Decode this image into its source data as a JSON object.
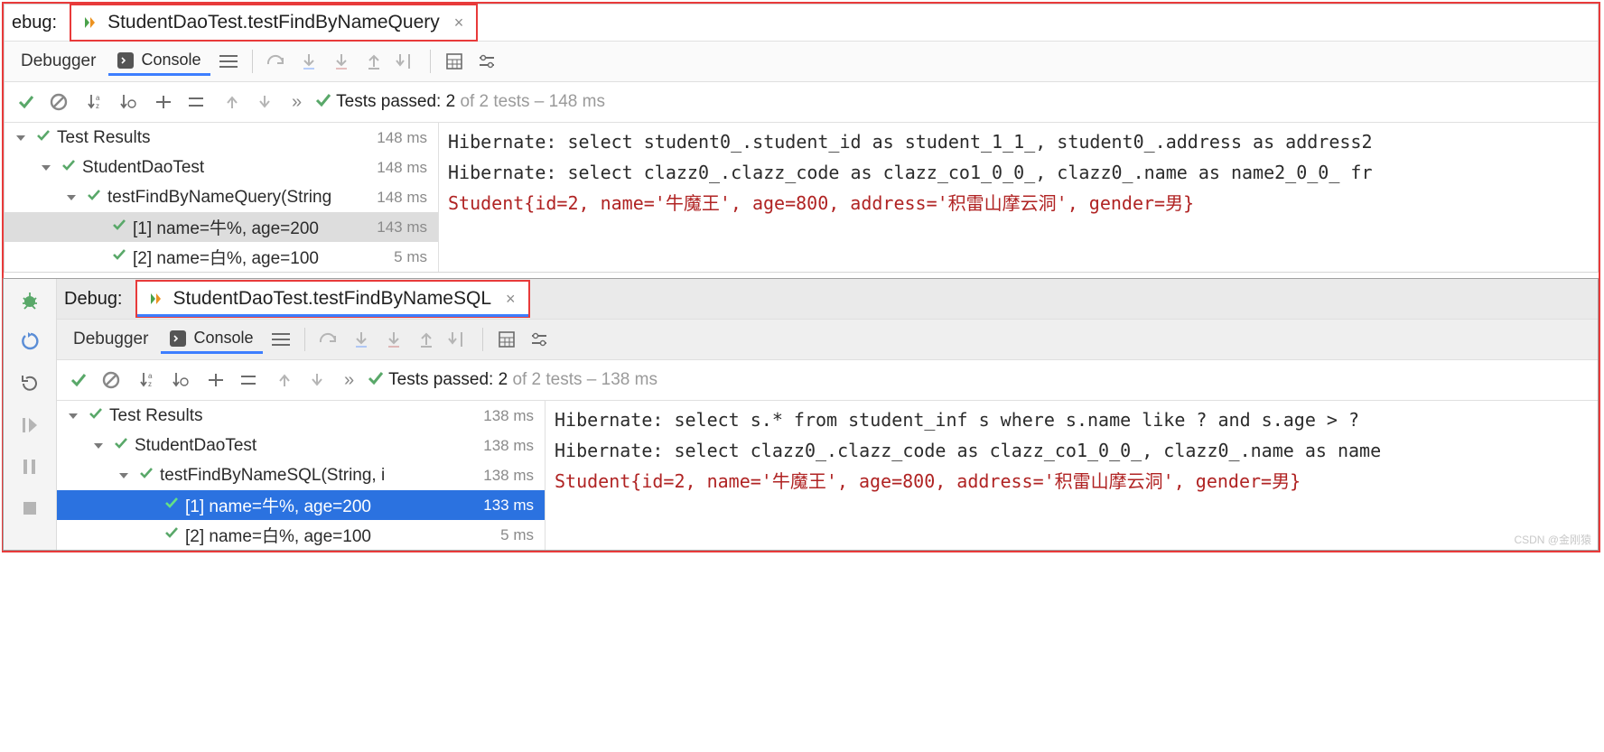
{
  "panel1": {
    "debug_label": "ebug:",
    "run_tab": "StudentDaoTest.testFindByNameQuery",
    "debugger_tab": "Debugger",
    "console_tab": "Console",
    "pass_prefix": "Tests passed:",
    "pass_count": "2",
    "pass_of": "of 2 tests – 148 ms",
    "tree": [
      {
        "indent": 0,
        "chev": true,
        "label": "Test Results",
        "ms": "148 ms",
        "sel": ""
      },
      {
        "indent": 1,
        "chev": true,
        "label": "StudentDaoTest",
        "ms": "148 ms",
        "sel": ""
      },
      {
        "indent": 2,
        "chev": true,
        "label": "testFindByNameQuery(String",
        "ms": "148 ms",
        "sel": ""
      },
      {
        "indent": 3,
        "chev": false,
        "label": "[1] name=牛%, age=200",
        "ms": "143 ms",
        "sel": "gray"
      },
      {
        "indent": 3,
        "chev": false,
        "label": "[2] name=白%, age=100",
        "ms": "5 ms",
        "sel": ""
      }
    ],
    "console": [
      {
        "cls": "",
        "text": "Hibernate: select student0_.student_id as student_1_1_, student0_.address as address2"
      },
      {
        "cls": "",
        "text": "Hibernate: select clazz0_.clazz_code as clazz_co1_0_0_, clazz0_.name as name2_0_0_ fr"
      },
      {
        "cls": "red-text",
        "text": "Student{id=2, name='牛魔王', age=800, address='积雷山摩云洞', gender=男}"
      }
    ]
  },
  "panel2": {
    "debug_label": "Debug:",
    "run_tab": "StudentDaoTest.testFindByNameSQL",
    "debugger_tab": "Debugger",
    "console_tab": "Console",
    "pass_prefix": "Tests passed:",
    "pass_count": "2",
    "pass_of": "of 2 tests – 138 ms",
    "tree": [
      {
        "indent": 0,
        "chev": true,
        "label": "Test Results",
        "ms": "138 ms",
        "sel": ""
      },
      {
        "indent": 1,
        "chev": true,
        "label": "StudentDaoTest",
        "ms": "138 ms",
        "sel": ""
      },
      {
        "indent": 2,
        "chev": true,
        "label": "testFindByNameSQL(String, i",
        "ms": "138 ms",
        "sel": ""
      },
      {
        "indent": 3,
        "chev": false,
        "label": "[1] name=牛%, age=200",
        "ms": "133 ms",
        "sel": "blue"
      },
      {
        "indent": 3,
        "chev": false,
        "label": "[2] name=白%, age=100",
        "ms": "5 ms",
        "sel": ""
      }
    ],
    "console": [
      {
        "cls": "",
        "text": "Hibernate: select s.* from student_inf s where s.name like ? and s.age > ?"
      },
      {
        "cls": "",
        "text": "Hibernate: select clazz0_.clazz_code as clazz_co1_0_0_, clazz0_.name as name"
      },
      {
        "cls": "red-text",
        "text": "Student{id=2, name='牛魔王', age=800, address='积雷山摩云洞', gender=男}"
      }
    ]
  },
  "watermark": "CSDN @金刚猿"
}
